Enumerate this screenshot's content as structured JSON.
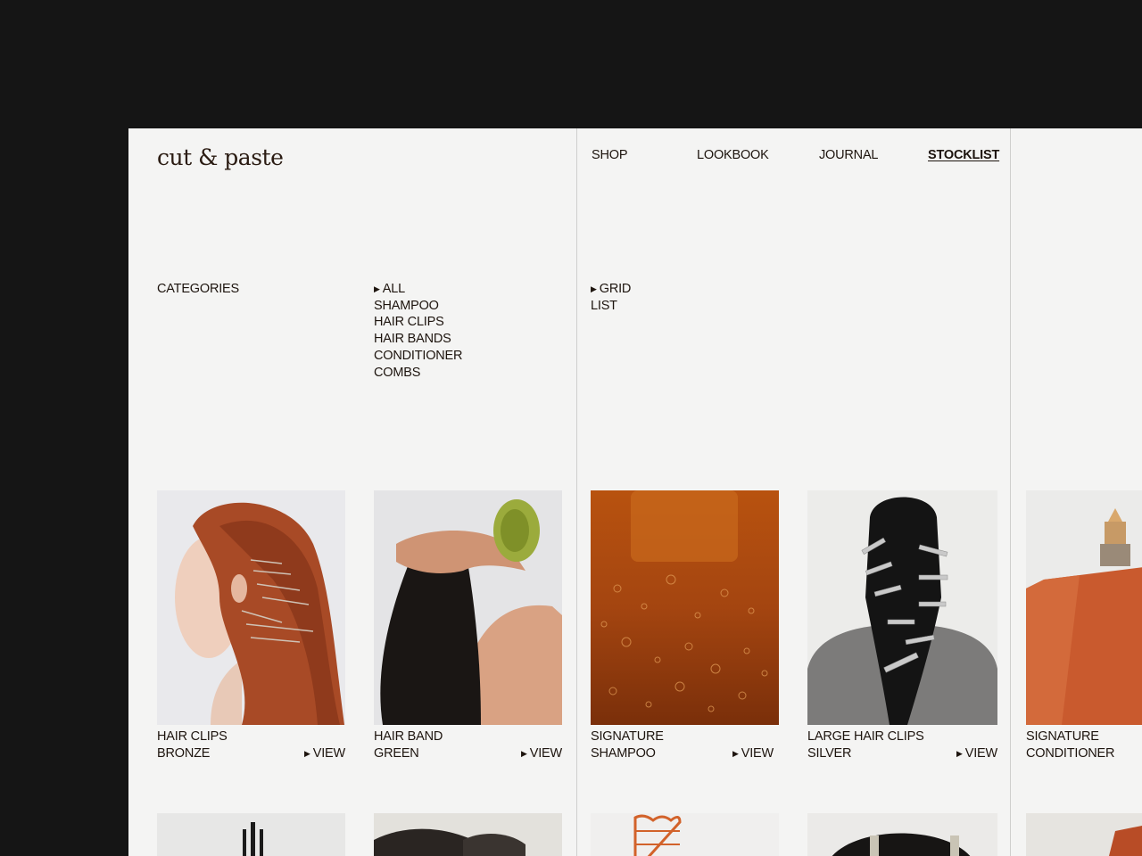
{
  "brand": {
    "logo": "cut & paste"
  },
  "nav": {
    "shop": "SHOP",
    "lookbook": "LOOKBOOK",
    "journal": "JOURNAL",
    "stocklist": "STOCKLIST"
  },
  "filters": {
    "heading": "CATEGORIES",
    "categories": [
      "ALL",
      "SHAMPOO",
      "HAIR CLIPS",
      "HAIR BANDS",
      "CONDITIONER",
      "COMBS"
    ],
    "selected_category": "ALL",
    "views": [
      "GRID",
      "LIST"
    ],
    "selected_view": "GRID"
  },
  "products": [
    {
      "line1": "HAIR CLIPS",
      "line2": "BRONZE",
      "action": "VIEW",
      "image": "red-hair-with-bronze-clips"
    },
    {
      "line1": "HAIR BAND",
      "line2": "GREEN",
      "action": "VIEW",
      "image": "black-hair-green-scrunchie"
    },
    {
      "line1": "SIGNATURE",
      "line2": "SHAMPOO",
      "action": "VIEW",
      "image": "amber-shampoo-bubbles"
    },
    {
      "line1": "LARGE HAIR CLIPS",
      "line2": "SILVER",
      "action": "VIEW",
      "image": "black-hair-silver-clips"
    },
    {
      "line1": "SIGNATURE",
      "line2": "CONDITIONER",
      "action": "",
      "image": "orange-conditioner-tube"
    }
  ],
  "colors": {
    "background": "#151515",
    "page": "#f4f4f3",
    "text": "#1d140e"
  }
}
